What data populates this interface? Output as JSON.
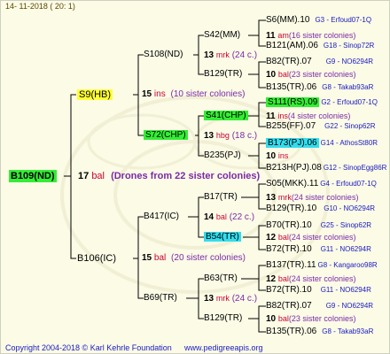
{
  "header": {
    "date": "14- 11-2018  ( 20:  1)"
  },
  "footer": {
    "copyright": "Copyright 2004-2018 © Karl Kehrle Foundation",
    "url": "www.pedigreeapis.org"
  },
  "colors": {
    "root_bg": "#33ee33",
    "yellow_hl": "#ffff33",
    "green_hl": "#33ee33",
    "cyan_hl": "#33ddee",
    "red_text": "#cc0033",
    "purple_text": "#7a2aa8",
    "blue_text": "#1a1ac0"
  },
  "root": {
    "id": "B109(ND)",
    "num": "17",
    "abbr": "bal",
    "note": "(Drones from 22 sister colonies)"
  },
  "gen1": [
    {
      "id": "S9(HB)",
      "num": "15",
      "abbr": "ins",
      "note": "(10 sister colonies)"
    },
    {
      "id": "B106(IC)",
      "num": "15",
      "abbr": "bal",
      "note": "(20 sister colonies)"
    }
  ],
  "gen2": [
    {
      "id": "S108(ND)",
      "num": "13",
      "abbr": "mrk",
      "note": "(24 c.)"
    },
    {
      "id": "S72(CHP)",
      "num": "13",
      "abbr": "hbg",
      "note": "(18 c.)"
    },
    {
      "id": "B417(IC)",
      "num": "14",
      "abbr": "bal",
      "note": "(22 c.)"
    },
    {
      "id": "B69(TR)",
      "num": "13",
      "abbr": "mrk",
      "note": "(24 c.)"
    }
  ],
  "gen3": [
    {
      "id": "S42(MM)",
      "num": "11",
      "abbr": "am",
      "note": "(16 sister colonies)"
    },
    {
      "id": "B129(TR)",
      "num": "10",
      "abbr": "bal",
      "note": "(23 sister colonies)"
    },
    {
      "id": "S41(CHP)",
      "num": "11",
      "abbr": "ins",
      "note": "(4 sister colonies)"
    },
    {
      "id": "B235(PJ)",
      "num": "10",
      "abbr": "ins",
      "note": ""
    },
    {
      "id": "B17(TR)",
      "num": "13",
      "abbr": "mrk",
      "note": "(24 sister colonies)"
    },
    {
      "id": "B54(TR)",
      "num": "12",
      "abbr": "bal",
      "note": "(24 sister colonies)"
    },
    {
      "id": "B63(TR)",
      "num": "12",
      "abbr": "bal",
      "note": "(24 sister colonies)"
    },
    {
      "id": "B129(TR)",
      "num": "10",
      "abbr": "bal",
      "note": "(23 sister colonies)"
    }
  ],
  "gen4": [
    {
      "id": "S6(MM).10",
      "code": "G3 - Erfoud07-1Q"
    },
    {
      "id": "B121(AM).06",
      "code": "G18 - Sinop72R"
    },
    {
      "id": "B82(TR).07",
      "code": "G9 - NO6294R"
    },
    {
      "id": "B135(TR).06",
      "code": "G8 - Takab93aR"
    },
    {
      "id": "S111(RS).09",
      "code": "G2 - Erfoud07-1Q"
    },
    {
      "id": "B255(FF).07",
      "code": "G22 - Sinop62R"
    },
    {
      "id": "B173(PJ).06",
      "code": "G14 - AthosSt80R"
    },
    {
      "id": "B213H(PJ).08",
      "code": "G12 - SinopEgg86R"
    },
    {
      "id": "S05(MKK).11",
      "code": "G4 - Erfoud07-1Q"
    },
    {
      "id": "B129(TR).10",
      "code": "G10 - NO6294R"
    },
    {
      "id": "B70(TR).10",
      "code": "G25 - Sinop62R"
    },
    {
      "id": "B72(TR).10",
      "code": "G11 - NO6294R"
    },
    {
      "id": "B137(TR).11",
      "code": "G8 - Kangaroo98R"
    },
    {
      "id": "B72(TR).10",
      "code": "G11 - NO6294R"
    },
    {
      "id": "B82(TR).07",
      "code": "G9 - NO6294R"
    },
    {
      "id": "B135(TR).06",
      "code": "G8 - Takab93aR"
    }
  ]
}
